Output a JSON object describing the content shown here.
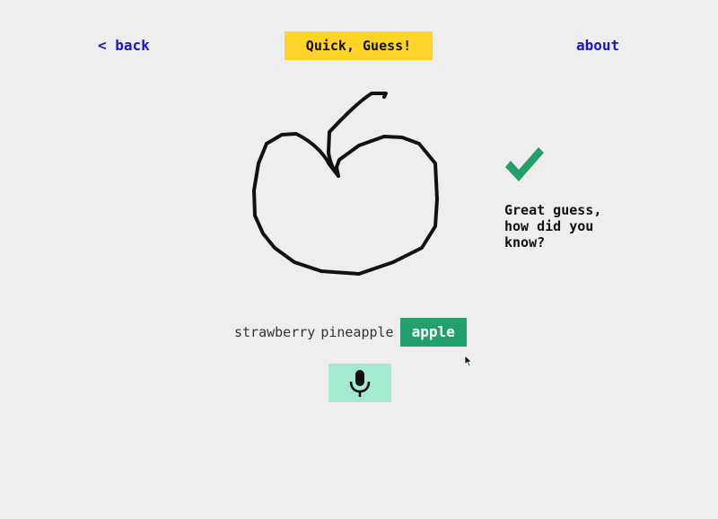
{
  "header": {
    "back_label": "< back",
    "title": "Quick, Guess!",
    "about_label": "about"
  },
  "result": {
    "icon": "check-icon",
    "message": "Great guess,\nhow did you\nknow?"
  },
  "guesses": {
    "options": [
      "strawberry",
      "pineapple",
      "apple"
    ],
    "selected": "apple"
  },
  "mic": {
    "icon": "microphone-icon"
  },
  "colors": {
    "link": "#1a14d6",
    "title_bg": "#ffd42a",
    "success": "#22a06b",
    "mic_bg": "#a3ead1",
    "background": "#eeeeee"
  }
}
